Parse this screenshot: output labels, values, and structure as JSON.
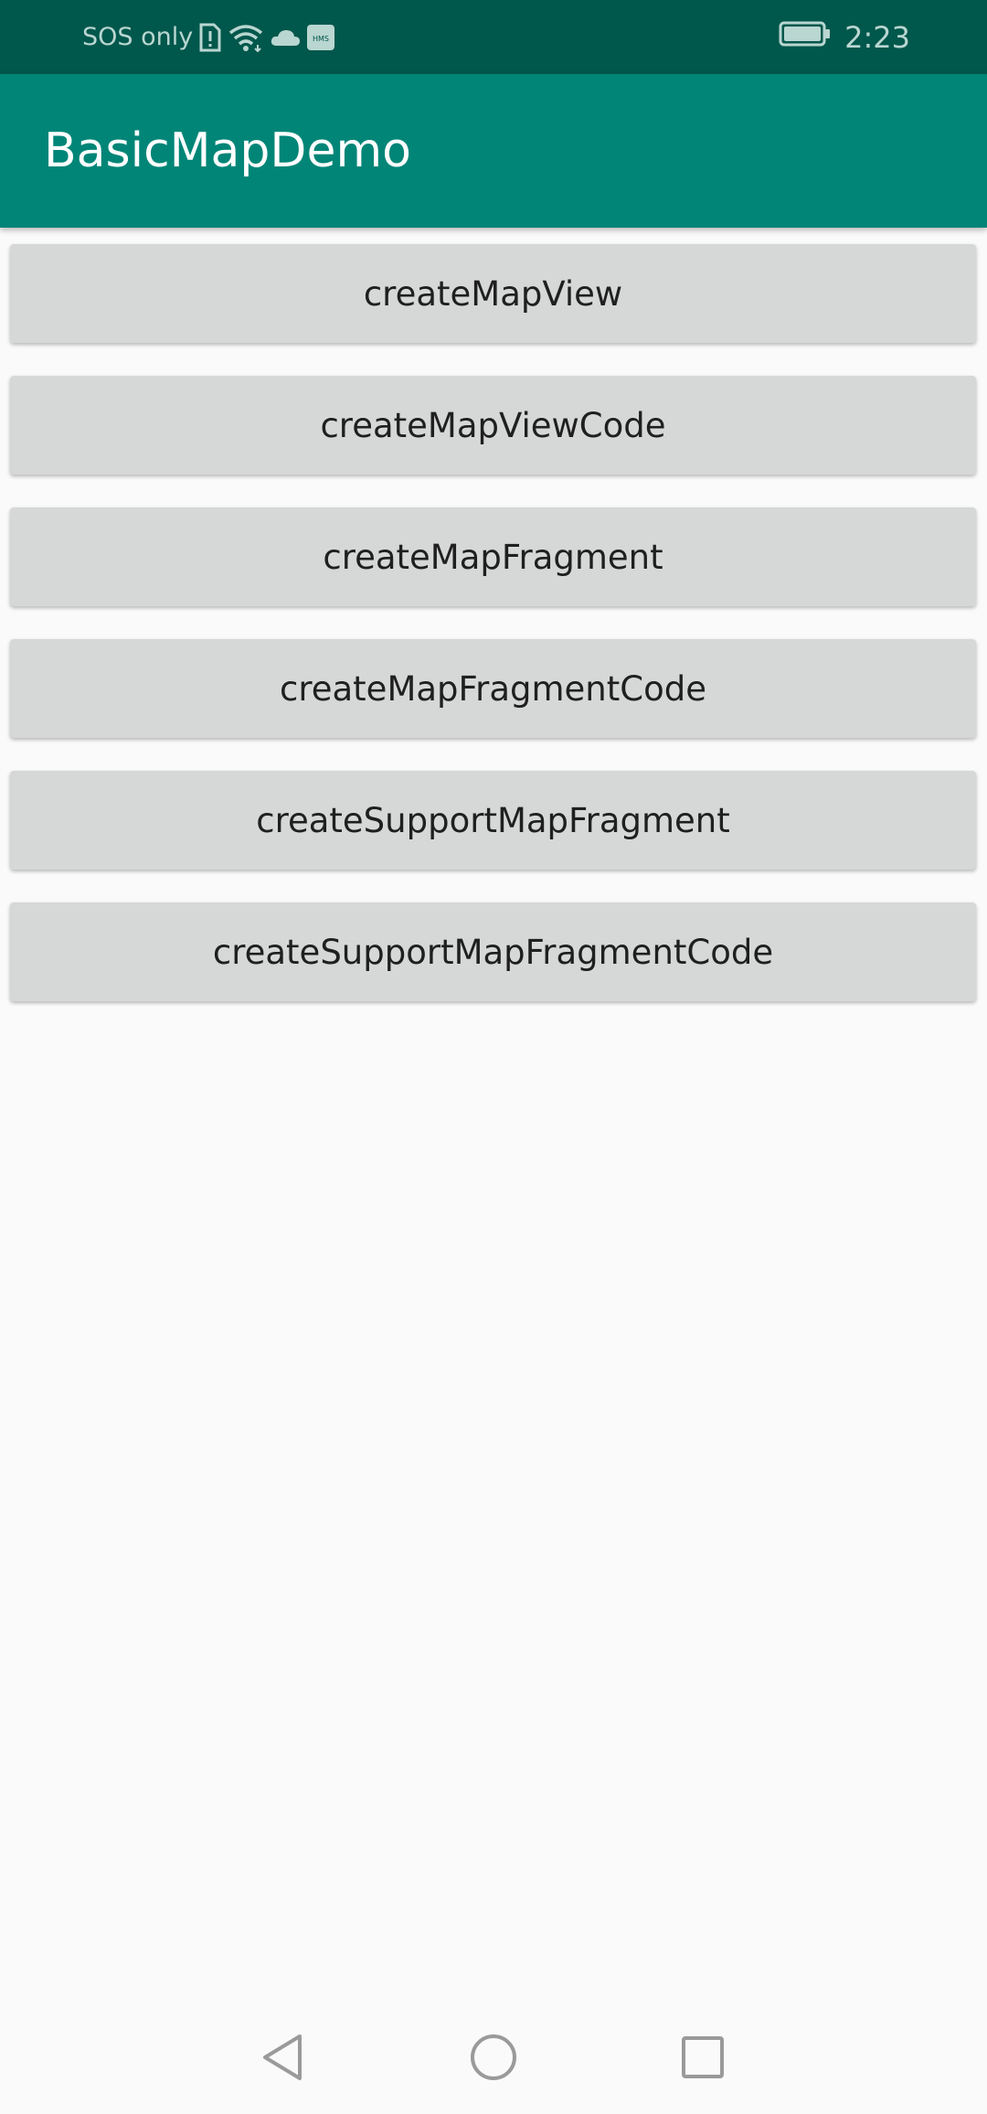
{
  "status_bar": {
    "carrier_text": "SOS only",
    "time": "2:23",
    "icons": [
      "sim-alert-icon",
      "wifi-icon",
      "cloud-icon",
      "hms-icon",
      "battery-icon"
    ],
    "hms_label": "HMS"
  },
  "app_bar": {
    "title": "BasicMapDemo",
    "color": "#008577"
  },
  "buttons": [
    {
      "label": "createMapView"
    },
    {
      "label": "createMapViewCode"
    },
    {
      "label": "createMapFragment"
    },
    {
      "label": "createMapFragmentCode"
    },
    {
      "label": "createSupportMapFragment"
    },
    {
      "label": "createSupportMapFragmentCode"
    }
  ],
  "nav_bar": {
    "icons": [
      "back-triangle-icon",
      "home-circle-icon",
      "recents-square-icon"
    ]
  }
}
